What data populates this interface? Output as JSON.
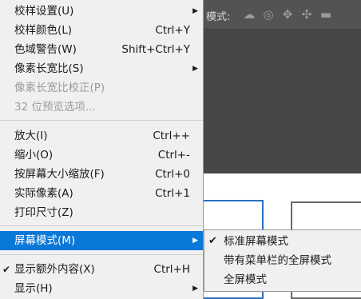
{
  "toolbar": {
    "mode_label": "模式:"
  },
  "menu": {
    "items": [
      {
        "label": "校样设置(U)",
        "shortcut": "",
        "submenu": true
      },
      {
        "label": "校样颜色(L)",
        "shortcut": "Ctrl+Y"
      },
      {
        "label": "色域警告(W)",
        "shortcut": "Shift+Ctrl+Y"
      },
      {
        "label": "像素长宽比(S)",
        "shortcut": "",
        "submenu": true
      },
      {
        "label": "像素长宽比校正(P)",
        "shortcut": "",
        "disabled": true
      },
      {
        "label": "32 位预览选项...",
        "shortcut": "",
        "disabled": true
      },
      {
        "label": "放大(I)",
        "shortcut": "Ctrl++"
      },
      {
        "label": "缩小(O)",
        "shortcut": "Ctrl+-"
      },
      {
        "label": "按屏幕大小缩放(F)",
        "shortcut": "Ctrl+0"
      },
      {
        "label": "实际像素(A)",
        "shortcut": "Ctrl+1"
      },
      {
        "label": "打印尺寸(Z)",
        "shortcut": ""
      },
      {
        "label": "屏幕模式(M)",
        "shortcut": "",
        "submenu": true,
        "highlighted": true
      },
      {
        "label": "显示额外内容(X)",
        "shortcut": "Ctrl+H",
        "checked": true
      },
      {
        "label": "显示(H)",
        "shortcut": "",
        "submenu": true
      }
    ]
  },
  "screen_mode_submenu": {
    "items": [
      {
        "label": "标准屏幕模式",
        "checked": true
      },
      {
        "label": "带有菜单栏的全屏模式"
      },
      {
        "label": "全屏模式"
      }
    ]
  },
  "glyphs": {
    "submenu_arrow": "▶",
    "check": "✔"
  }
}
